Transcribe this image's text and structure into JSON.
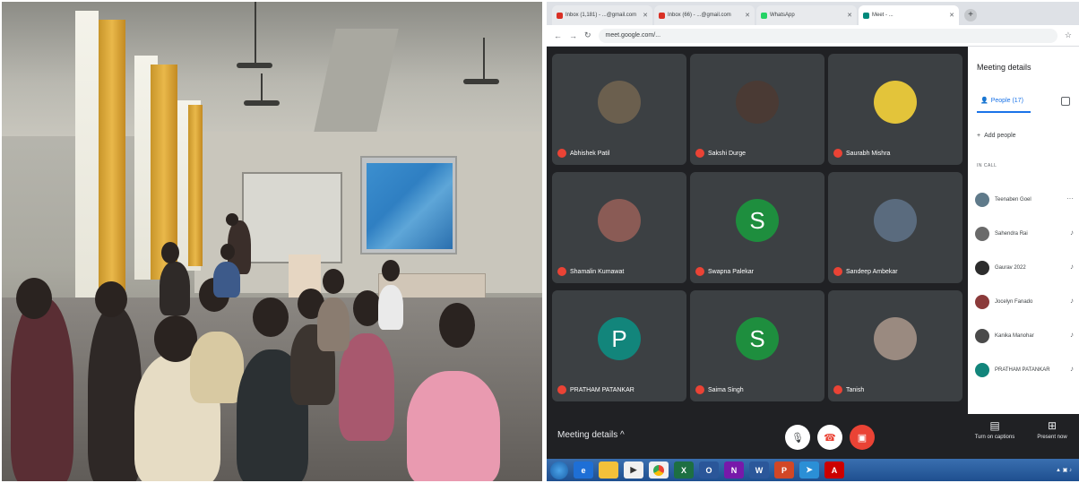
{
  "browser": {
    "tabs": [
      {
        "label": "Inbox (1,181) - ...@gmail.com",
        "icon": "gmail-icon",
        "active": false
      },
      {
        "label": "Inbox (66) - ...@gmail.com",
        "icon": "gmail-icon",
        "active": false
      },
      {
        "label": "WhatsApp",
        "icon": "whatsapp-icon",
        "active": false
      },
      {
        "label": "Meet - ...",
        "icon": "meet-icon",
        "active": true
      }
    ],
    "url": "meet.google.com/..."
  },
  "meet": {
    "tiles": [
      {
        "name": "Abhishek Patil",
        "initial": "",
        "color": "#6b5f4e"
      },
      {
        "name": "Sakshi Durge",
        "initial": "",
        "color": "#4a3a34"
      },
      {
        "name": "Saurabh Mishra",
        "initial": "",
        "color": "#e3c43a"
      },
      {
        "name": "Shamalin Kumawat",
        "initial": "",
        "color": "#8a5b55"
      },
      {
        "name": "Swapna Palekar",
        "initial": "S",
        "color": "#1e8e3e"
      },
      {
        "name": "Sandeep Ambekar",
        "initial": "",
        "color": "#5a6b7e"
      },
      {
        "name": "PRATHAM PATANKAR",
        "initial": "P",
        "color": "#12857b"
      },
      {
        "name": "Saima Singh",
        "initial": "S",
        "color": "#1e8e3e"
      },
      {
        "name": "Tanish",
        "initial": "",
        "color": "#9a8a80"
      }
    ],
    "panel": {
      "title": "Meeting details",
      "people_tab": "People (17)",
      "add_people": "Add people",
      "in_call": "IN CALL",
      "participants": [
        {
          "name": "Teenaben Goel",
          "color": "#5f7a8a",
          "more": "···"
        },
        {
          "name": "Sahendra Rai",
          "color": "#6a6a6a",
          "more": "♪"
        },
        {
          "name": "Gaurav 2022",
          "color": "#2c2c2c",
          "more": "♪"
        },
        {
          "name": "Jocelyn Fanado",
          "color": "#8b3a3a",
          "more": "♪"
        },
        {
          "name": "Kanika Manohar",
          "color": "#4a4a4a",
          "more": "♪"
        },
        {
          "name": "PRATHAM PATANKAR",
          "color": "#12857b",
          "more": "♪"
        }
      ]
    },
    "controls": {
      "meeting_details": "Meeting details ^",
      "captions_label": "Turn on captions",
      "present_label": "Present now"
    }
  },
  "colors": {
    "meet_bg": "#202124",
    "tile_bg": "#3c4043",
    "accent": "#1a73e8",
    "end_call": "#ea4335"
  }
}
